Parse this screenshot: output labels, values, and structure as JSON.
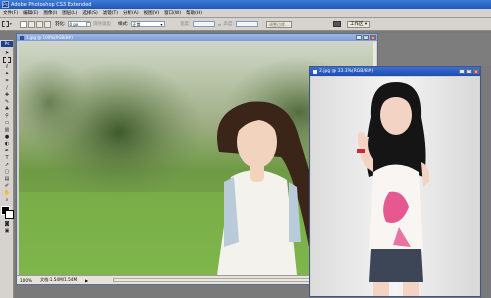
{
  "app": {
    "title": "Adobe Photoshop CS3 Extended",
    "badge": "Ps"
  },
  "menu": [
    "文件(F)",
    "编辑(E)",
    "图像(I)",
    "图层(L)",
    "选择(S)",
    "滤镜(T)",
    "分析(A)",
    "视图(V)",
    "窗口(W)",
    "帮助(H)"
  ],
  "options": {
    "feather_label": "羽化:",
    "feather_value": "0 px",
    "antialias_label": "消除锯齿",
    "style_label": "样式:",
    "style_value": "正常",
    "width_label": "宽度:",
    "height_label": "高度:",
    "refine_button": "调整边缘...",
    "workspace_label": "工作区 ▾"
  },
  "doc1": {
    "title": "1.jpg @ 100%(RGB/8#)",
    "zoom": "100%",
    "doc_info": "文档:1.54M/1.54M"
  },
  "doc2": {
    "title": "2.jpg @ 33.3%(RGB/8#)"
  },
  "colors": {
    "title_blue": "#2d62c4",
    "chrome_gray": "#d6d3ce",
    "workspace_gray": "#7a7a7a"
  }
}
